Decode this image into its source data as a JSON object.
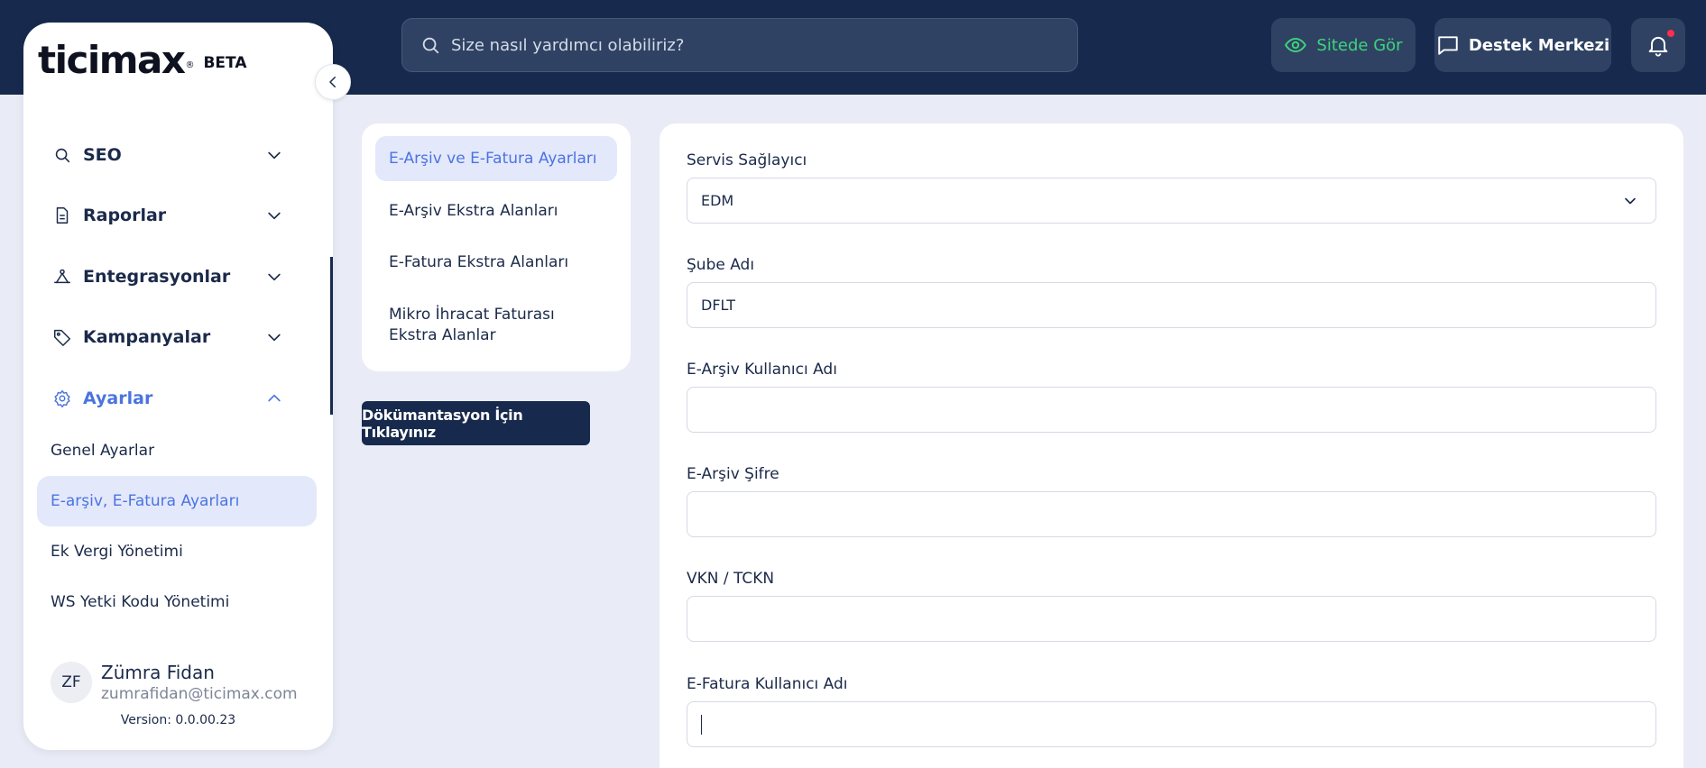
{
  "search": {
    "placeholder": "Size nasıl yardımcı olabiliriz?"
  },
  "header": {
    "site_label": "Sitede Gör",
    "support_label": "Destek Merkezi"
  },
  "brand": {
    "name": "ticimax",
    "tag": "BETA"
  },
  "sidebar": {
    "items": [
      {
        "label": "SEO",
        "icon": "search-icon"
      },
      {
        "label": "Raporlar",
        "icon": "document-icon"
      },
      {
        "label": "Entegrasyonlar",
        "icon": "integration-icon"
      },
      {
        "label": "Kampanyalar",
        "icon": "tag-icon"
      },
      {
        "label": "Ayarlar",
        "icon": "gear-icon",
        "active": true
      }
    ],
    "subitems": [
      {
        "label": "Genel Ayarlar"
      },
      {
        "label": "E-arşiv, E-Fatura Ayarları",
        "active": true
      },
      {
        "label": "Ek Vergi Yönetimi"
      },
      {
        "label": "WS Yetki Kodu Yönetimi"
      }
    ]
  },
  "user": {
    "initials": "ZF",
    "name": "Zümra Fidan",
    "email": "zumrafidan@ticimax.com",
    "version": "Version: 0.0.00.23"
  },
  "tabs": [
    {
      "label": "E-Arşiv ve E-Fatura Ayarları",
      "active": true
    },
    {
      "label": "E-Arşiv Ekstra Alanları"
    },
    {
      "label": "E-Fatura Ekstra Alanları"
    },
    {
      "label": "Mikro İhracat Faturası Ekstra Alanlar"
    }
  ],
  "doc_button": "Dökümantasyon İçin Tıklayınız",
  "form": {
    "provider_label": "Servis Sağlayıcı",
    "provider_value": "EDM",
    "branch_label": "Şube Adı",
    "branch_value": "DFLT",
    "earsiv_user_label": "E-Arşiv Kullanıcı Adı",
    "earsiv_user_value": "",
    "earsiv_pass_label": "E-Arşiv Şifre",
    "earsiv_pass_value": "",
    "vkn_label": "VKN / TCKN",
    "vkn_value": "",
    "efatura_user_label": "E-Fatura Kullanıcı Adı",
    "efatura_user_value": ""
  },
  "colors": {
    "header_bg": "#172a4d",
    "accent": "#4a74e0",
    "site_green": "#3ed47c",
    "page_bg": "#e9ecf6"
  }
}
